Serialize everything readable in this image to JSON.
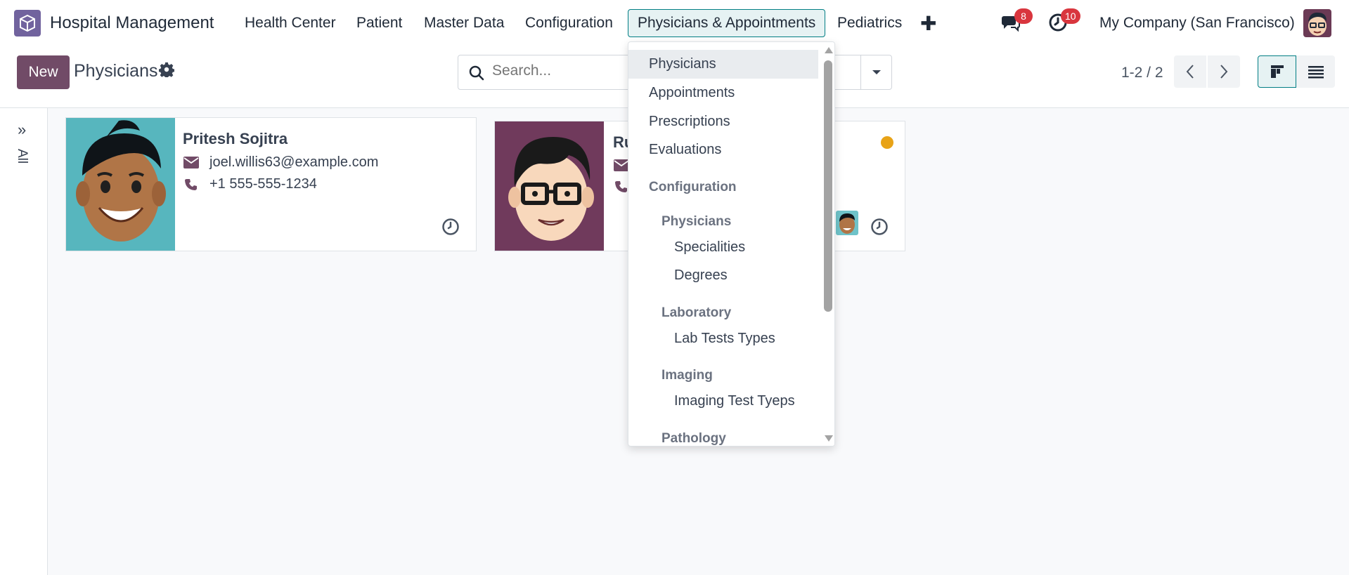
{
  "navbar": {
    "app_title": "Hospital Management",
    "menu": [
      "Health Center",
      "Patient",
      "Master Data",
      "Configuration",
      "Physicians & Appointments",
      "Pediatrics"
    ],
    "messages_badge": "8",
    "activities_badge": "10",
    "company": "My Company (San Francisco)"
  },
  "control": {
    "new_label": "New",
    "title": "Physicians",
    "search_placeholder": "Search...",
    "pager": "1-2 / 2"
  },
  "side": {
    "label": "All"
  },
  "cards": [
    {
      "name": "Pritesh Sojitra",
      "email": "joel.willis63@example.com",
      "phone": "+1 555-555-1234"
    },
    {
      "name_visible": "Ru"
    }
  ],
  "dropdown": {
    "items": [
      "Physicians",
      "Appointments",
      "Prescriptions",
      "Evaluations"
    ],
    "section": "Configuration",
    "groups": [
      {
        "title": "Physicians",
        "items": [
          "Specialities",
          "Degrees"
        ]
      },
      {
        "title": "Laboratory",
        "items": [
          "Lab Tests Types"
        ]
      },
      {
        "title": "Imaging",
        "items": [
          "Imaging Test Tyeps"
        ]
      },
      {
        "title": "Pathology",
        "items": []
      }
    ]
  },
  "colors": {
    "brand": "#714b67",
    "accent": "#017e84",
    "badge": "#d9363e",
    "status_dot": "#e8a317"
  },
  "icons": {
    "app": "hospital-cube-icon",
    "messages": "chat-bubbles-icon",
    "activities": "clock-check-icon",
    "settings": "gear-icon",
    "search": "search-icon",
    "email": "envelope-icon",
    "phone": "phone-icon",
    "activity": "clock-icon"
  }
}
